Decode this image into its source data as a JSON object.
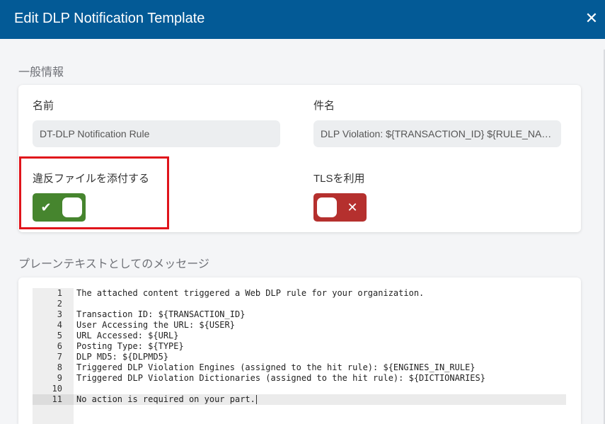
{
  "dialog": {
    "title": "Edit DLP Notification Template",
    "close_symbol": "✕"
  },
  "general": {
    "section_label": "一般情報",
    "name_label": "名前",
    "name_placeholder": "DT-DLP Notification Rule",
    "subject_label": "件名",
    "subject_placeholder": "DLP Violation: ${TRANSACTION_ID} ${RULE_NAME}",
    "attach_label": "違反ファイルを添付する",
    "attach_enabled": true,
    "tls_label": "TLSを利用",
    "tls_enabled": false
  },
  "icons": {
    "check": "✔",
    "cross": "✕"
  },
  "colors": {
    "header": "#035a96",
    "toggle_on": "#46852e",
    "toggle_off": "#b5302e",
    "highlight": "#e0141b"
  },
  "message": {
    "section_label": "プレーンテキストとしてのメッセージ",
    "line_numbers": [
      "1",
      "2",
      "3",
      "4",
      "5",
      "6",
      "7",
      "8",
      "9",
      "10",
      "11"
    ],
    "lines": [
      "The attached content triggered a Web DLP rule for your organization.",
      "",
      "Transaction ID: ${TRANSACTION_ID}",
      "User Accessing the URL: ${USER}",
      "URL Accessed: ${URL}",
      "Posting Type: ${TYPE}",
      "DLP MD5: ${DLPMD5}",
      "Triggered DLP Violation Engines (assigned to the hit rule): ${ENGINES_IN_RULE}",
      "Triggered DLP Violation Dictionaries (assigned to the hit rule): ${DICTIONARIES}",
      "",
      "No action is required on your part."
    ]
  }
}
